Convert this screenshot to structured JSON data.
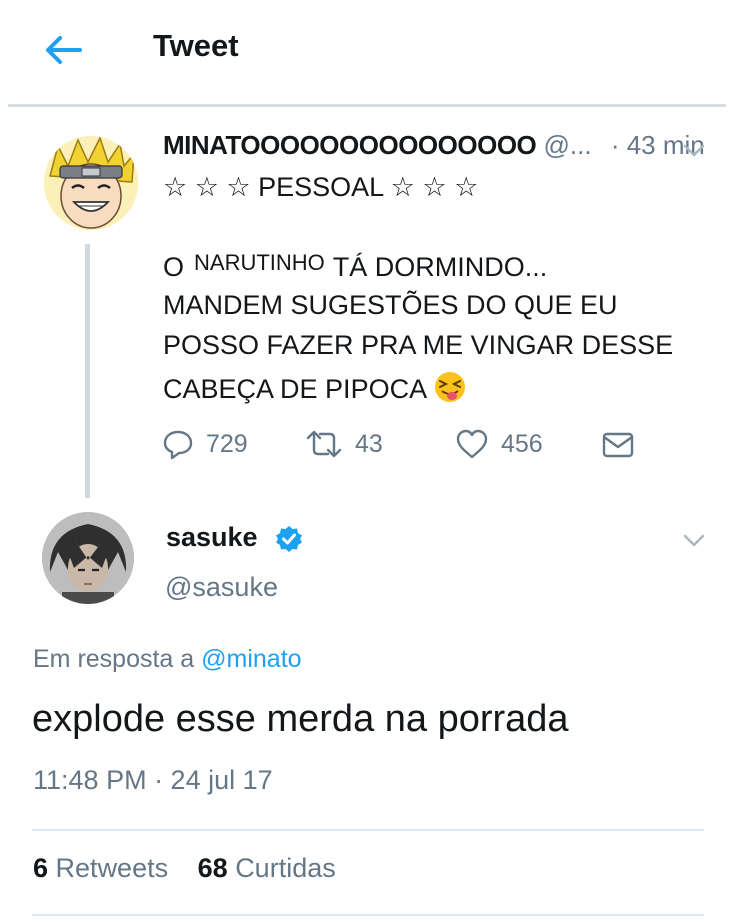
{
  "header": {
    "title": "Tweet"
  },
  "parent_tweet": {
    "author_name": "MINATOOOOOOOOOOOOOOO",
    "author_handle": "@...",
    "time": "· 43 min",
    "lines": {
      "stars_line": "☆ ☆ ☆ PESSOAL ☆ ☆ ☆",
      "l1_start": "O",
      "l1_nick": "NARUTINHO",
      "l1_end": "TÁ DORMINDO...",
      "l2": "MANDEM SUGESTÕES DO QUE EU",
      "l3": "POSSO FAZER PRA ME VINGAR DESSE",
      "l4": "CABEÇA DE PIPOCA"
    },
    "emoji_icon": "squinting-tongue-emoji",
    "actions": {
      "replies": "729",
      "retweets": "43",
      "likes": "456"
    }
  },
  "reply_tweet": {
    "author_name": "sasuke",
    "author_handle": "@sasuke",
    "verified": true,
    "reply_prefix": "Em resposta a",
    "reply_target": "@minato",
    "text": "explode esse merda na porrada",
    "timestamp": "11:48 PM · 24 jul 17",
    "retweets_count": "6",
    "retweets_label": "Retweets",
    "likes_count": "68",
    "likes_label": "Curtidas"
  },
  "colors": {
    "accent": "#1da1f2",
    "muted": "#657786",
    "text": "#14171a"
  }
}
